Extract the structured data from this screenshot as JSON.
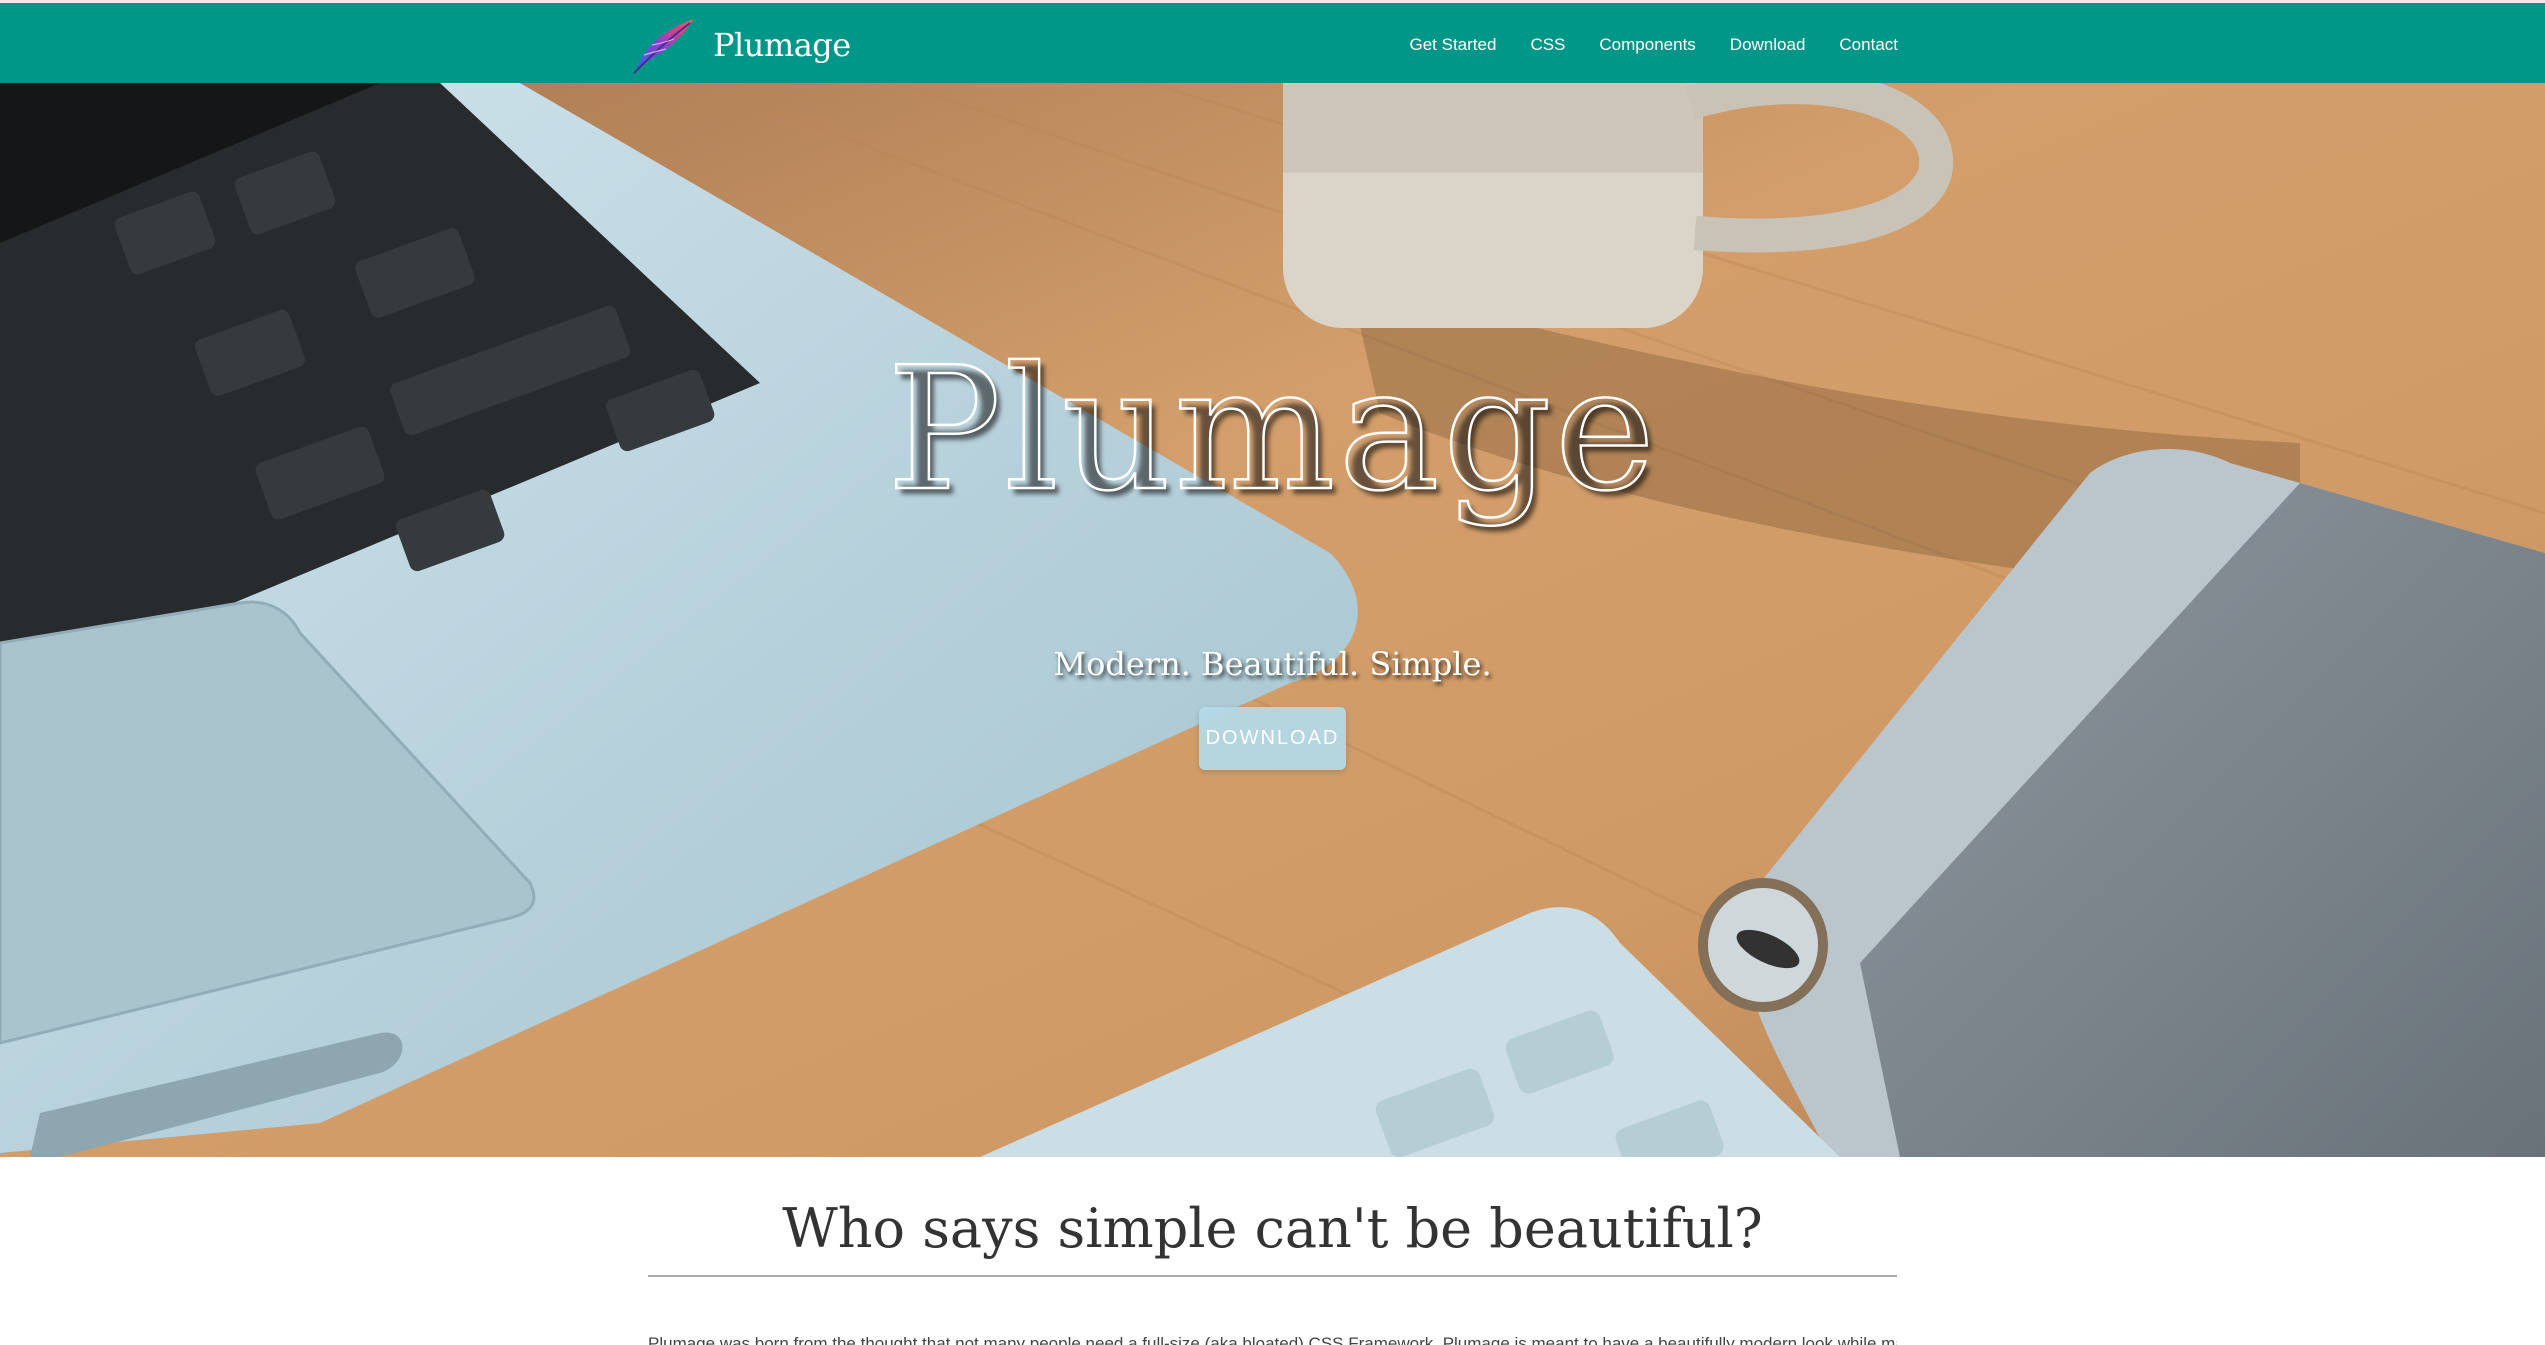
{
  "brand": {
    "name": "Plumage",
    "logo_icon": "feather-logo-icon"
  },
  "nav": {
    "items": [
      {
        "label": "Get Started"
      },
      {
        "label": "CSS"
      },
      {
        "label": "Components"
      },
      {
        "label": "Download"
      },
      {
        "label": "Contact"
      }
    ]
  },
  "hero": {
    "title": "Plumage",
    "tagline": "Modern. Beautiful. Simple.",
    "button_label": "Download"
  },
  "content": {
    "heading": "Who says simple can't be beautiful?",
    "intro": "Plumage was born from the thought that not many people need a full-size (aka bloated) CSS Framework. Plumage is meant to have a beautifully modern look while maintaining"
  },
  "colors": {
    "navbar": "#009688",
    "button": "#b3d9e8",
    "text_dark": "#333333"
  }
}
